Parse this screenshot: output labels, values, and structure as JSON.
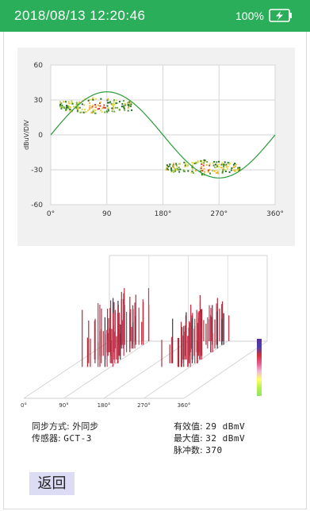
{
  "status_bar": {
    "datetime": "2018/08/13  12:20:46",
    "battery_text": "100%",
    "battery_icon": "battery-charging-icon"
  },
  "chart_data": [
    {
      "type": "scatter",
      "title": "",
      "ylabel": "dBuV/DIV",
      "xlabel": "",
      "xlim": [
        0,
        360
      ],
      "ylim": [
        -60,
        60
      ],
      "x_tick_labels": [
        "0°",
        "90",
        "180°",
        "270°",
        "360°"
      ],
      "y_tick_labels": [
        "60",
        "30",
        "0",
        "-30",
        "-60"
      ],
      "grid": true,
      "reference_curve": "sine",
      "sine_amplitude": 37,
      "clusters": [
        {
          "x_range": [
            15,
            130
          ],
          "y_range": [
            15,
            30
          ],
          "center": [
            75,
            25
          ]
        },
        {
          "x_range": [
            185,
            305
          ],
          "y_range": [
            -33,
            -20
          ],
          "center": [
            245,
            -28
          ]
        }
      ]
    },
    {
      "type": "bar",
      "title": "",
      "xlabel": "",
      "ylabel": "",
      "x_tick_labels": [
        "0°",
        "90°",
        "180°",
        "270°",
        "360°"
      ],
      "pulse_groups": [
        {
          "phase_range": [
            40,
            110
          ],
          "relative_height": 0.9
        },
        {
          "phase_range": [
            220,
            290
          ],
          "relative_height": 0.75
        }
      ],
      "color_scale": [
        "#5a2d9e",
        "#d1303a",
        "#f0b9d8",
        "#ffff66",
        "#8ee66a"
      ]
    }
  ],
  "info": {
    "sync_mode_label": "同步方式:",
    "sync_mode_value": "外同步",
    "sensor_label": "传感器:",
    "sensor_value": "GCT-3",
    "rms_label": "有效值:",
    "rms_value": "29 dBmV",
    "max_label": "最大值:",
    "max_value": "32 dBmV",
    "pulse_count_label": "脉冲数:",
    "pulse_count_value": "370"
  },
  "back_button": {
    "label": "返回"
  },
  "colors": {
    "status_bar": "#2aae5a",
    "sine_curve": "#2a9a3a",
    "plot_background": "#f1f1f1",
    "button_background": "#dcdcf4",
    "pulse_bar": "#b02e3c"
  }
}
